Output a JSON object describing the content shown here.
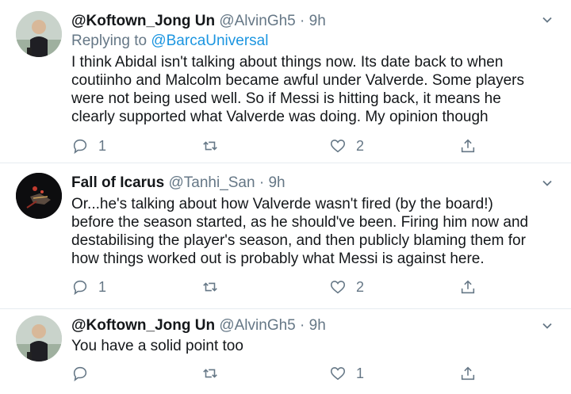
{
  "tweets": [
    {
      "name": "@Koftown_Jong Un",
      "handle": "@AlvinGh5",
      "dot": "·",
      "time": "9h",
      "reply_prefix": "Replying to",
      "reply_to": "@BarcaUniversal",
      "lines": [
        "I think Abidal isn't talking about things now. Its date back to when",
        "coutiinho and Malcolm became awful under Valverde. Some players",
        "were not being used well. So if Messi is hitting back, it means he",
        "clearly supported what Valverde was doing. My opinion though"
      ],
      "replies": "1",
      "retweets": "",
      "likes": "2",
      "avatar_icon": "user-avatar"
    },
    {
      "name": "Fall of Icarus",
      "handle": "@Tanhi_San",
      "dot": "·",
      "time": "9h",
      "lines": [
        "Or...he's talking about how Valverde wasn't fired (by the board!)",
        "before the season started, as he should've been. Firing him now and",
        "destabilising the player's season, and then publicly blaming them for",
        "how things worked out is probably what Messi is against here."
      ],
      "replies": "1",
      "retweets": "",
      "likes": "2",
      "avatar_icon": "user-avatar"
    },
    {
      "name": "@Koftown_Jong Un",
      "handle": "@AlvinGh5",
      "dot": "·",
      "time": "9h",
      "lines": [
        "You have a solid  point too"
      ],
      "replies": "",
      "retweets": "",
      "likes": "1",
      "avatar_icon": "user-avatar"
    }
  ],
  "colors": {
    "text": "#14171a",
    "muted": "#657786",
    "link": "#1b95e0",
    "divider": "#e6ecf0"
  },
  "icons": [
    "reply-icon",
    "retweet-icon",
    "like-icon",
    "share-icon",
    "chevron-down-icon"
  ]
}
